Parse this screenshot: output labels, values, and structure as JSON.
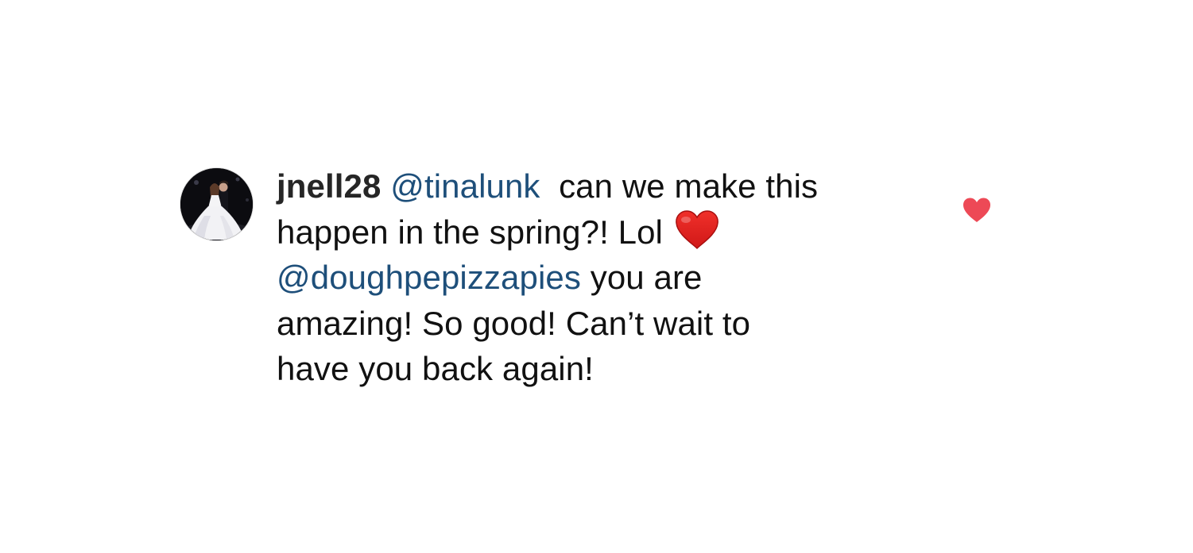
{
  "comment": {
    "username": "jnell28",
    "mention_1": "@tinalunk",
    "text_1": "  can we make this",
    "text_2": "happen in the spring?! Lol ",
    "mention_2": "@doughpepizzapies",
    "text_3": " you are",
    "text_4": "amazing! So good! Can’t wait to",
    "text_5": "have you back again!",
    "emoji": "red-heart-emoji"
  },
  "like": {
    "icon": "heart-icon",
    "liked": true,
    "color": "#ed4956"
  },
  "colors": {
    "mention": "#1e4f7a",
    "text": "#111111",
    "username": "#262626"
  }
}
